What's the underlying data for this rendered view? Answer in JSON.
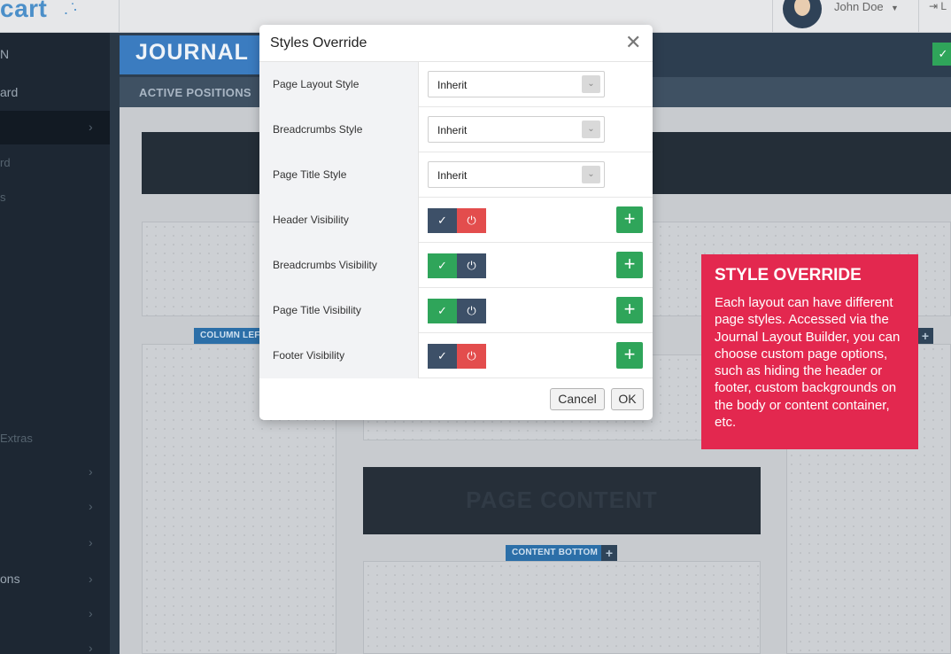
{
  "header": {
    "logo_text": "cart",
    "user_name": "John Doe",
    "logout_label": "L"
  },
  "sidebar": {
    "items": [
      {
        "label": "N"
      },
      {
        "label": "ard"
      },
      {
        "label": ""
      },
      {
        "label": "rd"
      },
      {
        "label": "s"
      },
      {
        "label": "Extras"
      },
      {
        "label": ""
      },
      {
        "label": ""
      },
      {
        "label": ""
      },
      {
        "label": "ons"
      },
      {
        "label": ""
      },
      {
        "label": ""
      }
    ]
  },
  "journal": {
    "title": "JOURNAL",
    "active_positions_label": "ACTIVE POSITIONS",
    "column_left_label": "COLUMN LEFT",
    "content_bottom_label": "CONTENT BOTTOM",
    "page_content_label": "PAGE CONTENT"
  },
  "modal": {
    "title": "Styles Override",
    "rows": [
      {
        "label": "Page Layout Style",
        "type": "select",
        "value": "Inherit"
      },
      {
        "label": "Breadcrumbs Style",
        "type": "select",
        "value": "Inherit"
      },
      {
        "label": "Page Title Style",
        "type": "select",
        "value": "Inherit"
      },
      {
        "label": "Header Visibility",
        "type": "toggle",
        "state": "off"
      },
      {
        "label": "Breadcrumbs Visibility",
        "type": "toggle",
        "state": "on"
      },
      {
        "label": "Page Title Visibility",
        "type": "toggle",
        "state": "on"
      },
      {
        "label": "Footer Visibility",
        "type": "toggle",
        "state": "off"
      }
    ],
    "cancel_label": "Cancel",
    "ok_label": "OK"
  },
  "callout": {
    "title": "STYLE OVERRIDE",
    "text": "Each layout can have different page styles. Accessed via the Journal Layout Builder, you can choose custom page options, such as hiding the header or footer, custom backgrounds on the body or content container, etc."
  },
  "icons": {
    "check": "check-icon",
    "power": "power-icon",
    "plus": "plus-icon",
    "close": "close-icon",
    "chevron": "chevron-right-icon"
  },
  "colors": {
    "toggle_on_green": "#2fa55a",
    "toggle_off_red": "#e34d4d",
    "toggle_dark": "#3d5068",
    "callout_red": "#e3284f",
    "sidebar_bg": "#1d2733"
  }
}
